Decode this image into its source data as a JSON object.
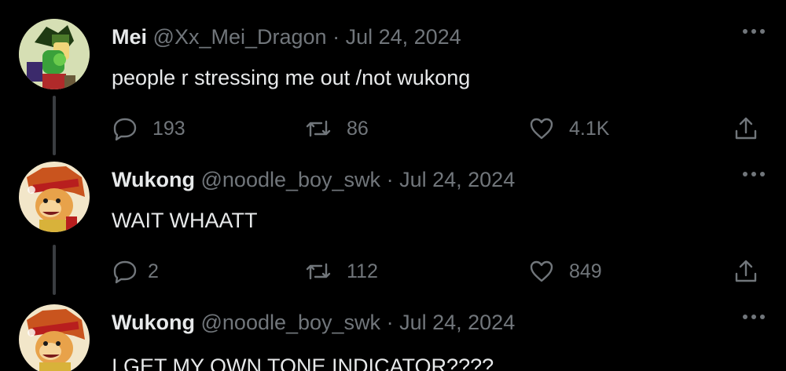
{
  "colors": {
    "background": "#000000",
    "text_primary": "#e7e9ea",
    "text_secondary": "#71767b",
    "thread_line": "#3a3d41"
  },
  "tweets": [
    {
      "name": "Mei",
      "handle": "@Xx_Mei_Dragon",
      "separator": "·",
      "date": "Jul 24, 2024",
      "text": "people r stressing me out /not wukong",
      "avatar_icon": "green-dragon-avatar",
      "replies": "193",
      "retweets": "86",
      "likes": "4.1K"
    },
    {
      "name": "Wukong",
      "handle": "@noodle_boy_swk",
      "separator": "·",
      "date": "Jul 24, 2024",
      "text": "WAIT WHAATT",
      "avatar_icon": "monkey-king-avatar",
      "replies": "2",
      "retweets": "112",
      "likes": "849"
    },
    {
      "name": "Wukong",
      "handle": "@noodle_boy_swk",
      "separator": "·",
      "date": "Jul 24, 2024",
      "text": "I GET MY OWN TONE INDICATOR????",
      "avatar_icon": "monkey-king-avatar"
    }
  ]
}
